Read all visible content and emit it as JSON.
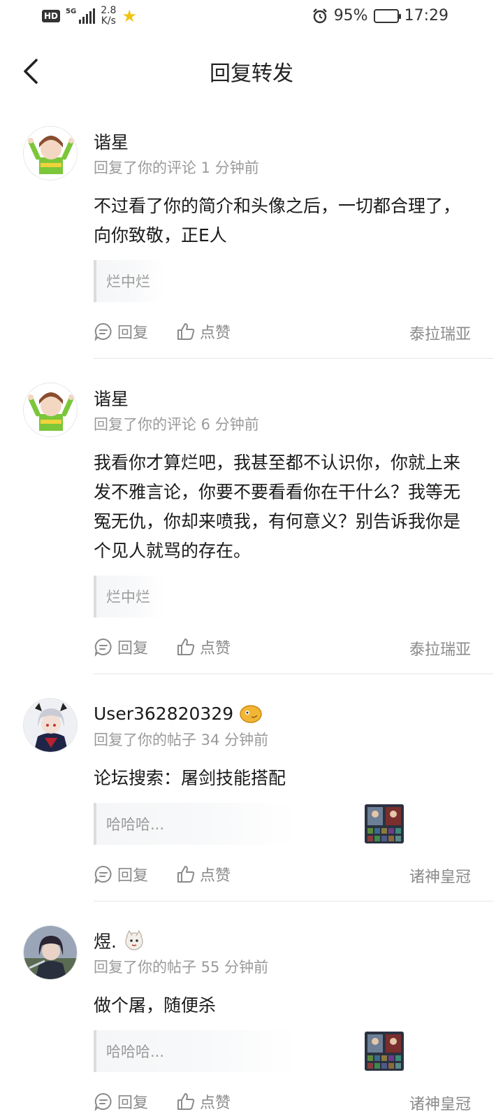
{
  "status_bar": {
    "hd": "HD",
    "network": "5G",
    "speed_value": "2.8",
    "speed_unit": "K/s",
    "battery": "95%",
    "time": "17:29"
  },
  "header": {
    "title": "回复转发"
  },
  "actions": {
    "reply": "回复",
    "like": "点赞"
  },
  "items": [
    {
      "username": "谐星",
      "meta": "回复了你的评论 1 分钟前",
      "content": "不过看了你的简介和头像之后，一切都合理了，向你致敬，正E人",
      "quote": "烂中烂",
      "source": "泰拉瑞亚"
    },
    {
      "username": "谐星",
      "meta": "回复了你的评论 6 分钟前",
      "content": "我看你才算烂吧，我甚至都不认识你，你就上来发不雅言论，你要不要看看你在干什么？我等无冤无仇，你却来喷我，有何意义？别告诉我你是个见人就骂的存在。",
      "quote": "烂中烂",
      "source": "泰拉瑞亚"
    },
    {
      "username": "User362820329",
      "meta": "回复了你的帖子 34 分钟前",
      "content": "论坛搜索：屠剑技能搭配",
      "quote": "哈哈哈...",
      "source": "诸神皇冠"
    },
    {
      "username": "煜.",
      "meta": "回复了你的帖子 55 分钟前",
      "content": "做个屠，随便杀",
      "quote": "哈哈哈...",
      "source": "诸神皇冠"
    }
  ]
}
